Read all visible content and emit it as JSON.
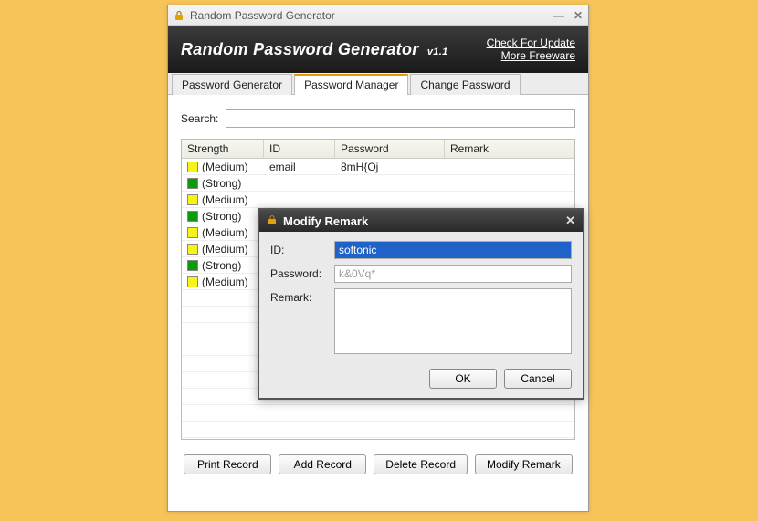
{
  "window": {
    "title": "Random Password Generator"
  },
  "banner": {
    "title_main": "Random Password Generator",
    "title_ver": "v1.1",
    "links": {
      "update": "Check For Update",
      "freeware": "More Freeware"
    }
  },
  "tabs": {
    "generator": "Password Generator",
    "manager": "Password Manager",
    "change": "Change Password"
  },
  "search": {
    "label": "Search:",
    "value": ""
  },
  "table": {
    "headers": {
      "strength": "Strength",
      "id": "ID",
      "password": "Password",
      "remark": "Remark"
    },
    "rows": [
      {
        "strength_class": "sw-med",
        "strength": "(Medium)",
        "id": "email",
        "password": "8mH{Oj",
        "remark": ""
      },
      {
        "strength_class": "sw-str",
        "strength": "(Strong)",
        "id": "",
        "password": "",
        "remark": ""
      },
      {
        "strength_class": "sw-med",
        "strength": "(Medium)",
        "id": "",
        "password": "",
        "remark": ""
      },
      {
        "strength_class": "sw-str",
        "strength": "(Strong)",
        "id": "",
        "password": "",
        "remark": ""
      },
      {
        "strength_class": "sw-med",
        "strength": "(Medium)",
        "id": "",
        "password": "",
        "remark": ""
      },
      {
        "strength_class": "sw-med",
        "strength": "(Medium)",
        "id": "",
        "password": "",
        "remark": ""
      },
      {
        "strength_class": "sw-str",
        "strength": "(Strong)",
        "id": "",
        "password": "",
        "remark": ""
      },
      {
        "strength_class": "sw-med",
        "strength": "(Medium)",
        "id": "",
        "password": "",
        "remark": ""
      }
    ]
  },
  "buttons": {
    "print": "Print Record",
    "add": "Add Record",
    "delete": "Delete Record",
    "modify": "Modify Remark"
  },
  "modal": {
    "title": "Modify Remark",
    "id_label": "ID:",
    "id_value": "softonic",
    "pw_label": "Password:",
    "pw_value": "k&0Vq*",
    "remark_label": "Remark:",
    "remark_value": "",
    "ok": "OK",
    "cancel": "Cancel"
  },
  "strength_colors": {
    "medium": "#f7f31a",
    "strong": "#0a9a0a"
  }
}
